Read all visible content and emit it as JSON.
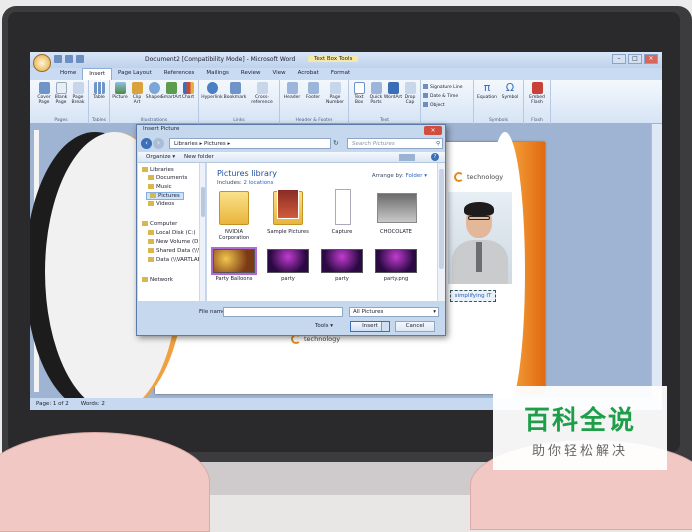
{
  "word": {
    "window_title": "Document2 [Compatibility Mode] - Microsoft Word",
    "context_tab_title": "Text Box Tools",
    "tabs": [
      "Home",
      "Insert",
      "Page Layout",
      "References",
      "Mailings",
      "Review",
      "View",
      "Acrobat",
      "Format"
    ],
    "active_tab": "Insert",
    "ribbon_groups": [
      {
        "label": "Pages",
        "buttons": [
          "Cover Page",
          "Blank Page",
          "Page Break"
        ]
      },
      {
        "label": "Tables",
        "buttons": [
          "Table"
        ]
      },
      {
        "label": "Illustrations",
        "buttons": [
          "Picture",
          "Clip Art",
          "Shapes",
          "SmartArt",
          "Chart"
        ]
      },
      {
        "label": "Links",
        "buttons": [
          "Hyperlink",
          "Bookmark",
          "Cross-reference"
        ]
      },
      {
        "label": "Header & Footer",
        "buttons": [
          "Header",
          "Footer",
          "Page Number"
        ]
      },
      {
        "label": "Text",
        "buttons": [
          "Text Box",
          "Quick Parts",
          "WordArt",
          "Drop Cap"
        ]
      },
      {
        "label": "",
        "buttons": [
          "Signature Line",
          "Date & Time",
          "Object"
        ]
      },
      {
        "label": "Symbols",
        "buttons": [
          "Equation",
          "Symbol"
        ]
      },
      {
        "label": "Flash",
        "buttons": [
          "Embed Flash"
        ]
      }
    ],
    "status": {
      "page": "Page: 1 of 2",
      "words": "Words: 2"
    }
  },
  "brochure": {
    "logo_text": "technology",
    "tagline": "simplifying IT"
  },
  "dialog": {
    "title": "Insert Picture",
    "address": "Libraries ▸ Pictures ▸",
    "search_placeholder": "Search Pictures",
    "organize": "Organize ▾",
    "new_folder": "New folder",
    "nav": {
      "libraries": "Libraries",
      "documents": "Documents",
      "music": "Music",
      "pictures": "Pictures",
      "videos": "Videos",
      "computer": "Computer",
      "local_disk": "Local Disk (C:)",
      "new_volume": "New Volume (D:)",
      "shared_data": "Shared Data (\\\\VA",
      "data": "Data (\\\\VARTLAB)",
      "network": "Network"
    },
    "library_title": "Pictures library",
    "includes_label": "Includes:",
    "includes_value": "2 locations",
    "arrange_label": "Arrange by:",
    "arrange_value": "Folder ▾",
    "items": [
      "NVIDIA Corporation",
      "Sample Pictures",
      "Capture",
      "CHOCOLATE",
      "Party Balloons",
      "party",
      "party",
      "party.png"
    ],
    "file_name_label": "File name:",
    "file_name_value": "",
    "filter_value": "All Pictures",
    "tools": "Tools ▾",
    "insert": "Insert",
    "cancel": "Cancel"
  },
  "watermark": {
    "main": "百科全说",
    "sub": "助你轻松解决"
  }
}
